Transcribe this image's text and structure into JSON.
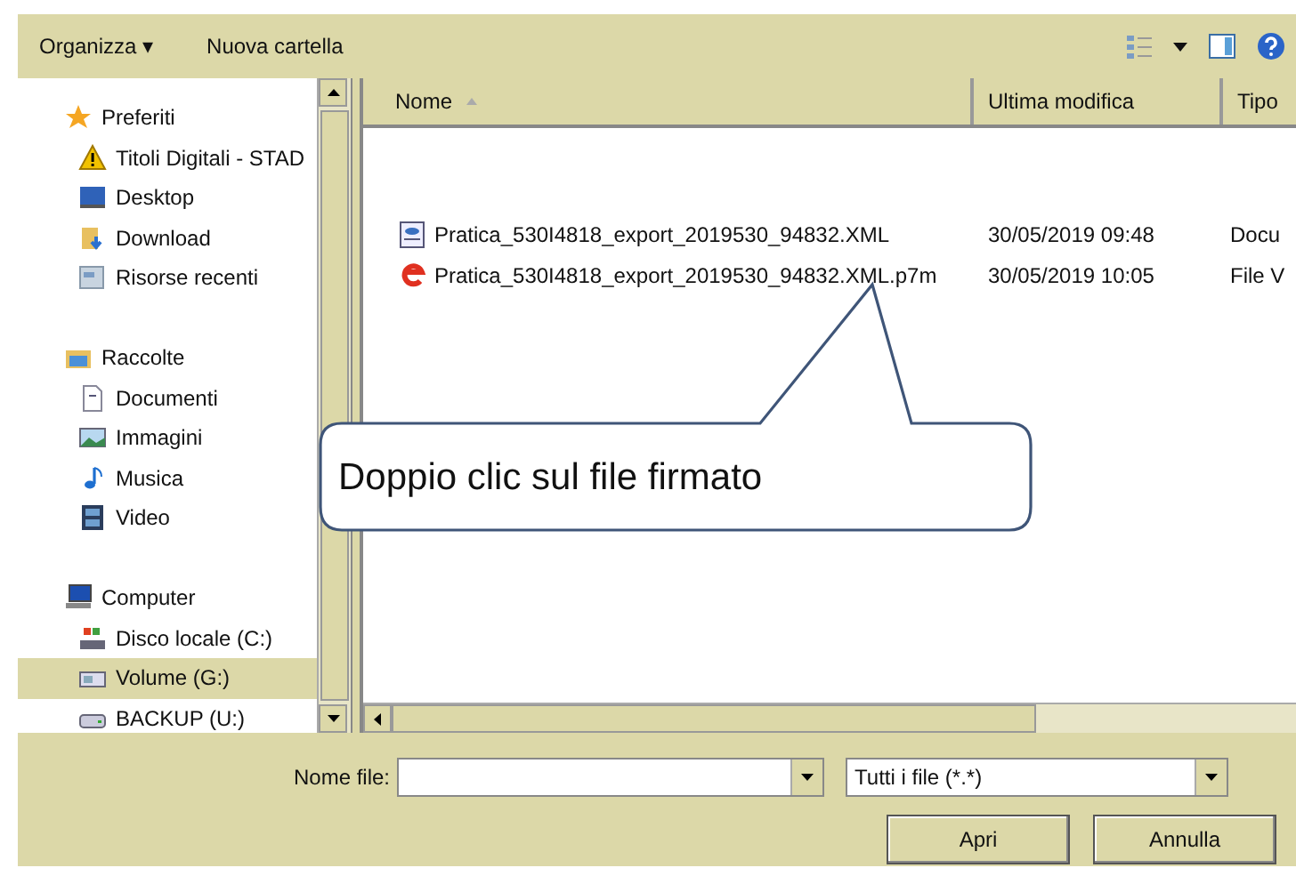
{
  "toolbar": {
    "organize": "Organizza ▾",
    "new_folder": "Nuova cartella"
  },
  "nav": [
    {
      "label": "Preferiti",
      "kind": "favorites",
      "selected": false,
      "children": [
        {
          "label": "Titoli Digitali - STAD",
          "kind": "warning",
          "selected": false
        },
        {
          "label": "Desktop",
          "kind": "desktop",
          "selected": false
        },
        {
          "label": "Download",
          "kind": "download",
          "selected": false
        },
        {
          "label": "Risorse recenti",
          "kind": "recent",
          "selected": false
        }
      ]
    },
    {
      "label": "Raccolte",
      "kind": "libraries",
      "selected": false,
      "children": [
        {
          "label": "Documenti",
          "kind": "document",
          "selected": false
        },
        {
          "label": "Immagini",
          "kind": "image",
          "selected": false
        },
        {
          "label": "Musica",
          "kind": "music",
          "selected": false
        },
        {
          "label": "Video",
          "kind": "video",
          "selected": false
        }
      ]
    },
    {
      "label": "Computer",
      "kind": "computer",
      "selected": false,
      "children": [
        {
          "label": "Disco locale (C:)",
          "kind": "disk",
          "selected": false
        },
        {
          "label": "Volume (G:)",
          "kind": "volume",
          "selected": true
        },
        {
          "label": "BACKUP (U:)",
          "kind": "drive",
          "selected": false
        }
      ]
    }
  ],
  "table": {
    "columns": [
      "Nome",
      "Ultima modifica",
      "Tipo"
    ],
    "rows": [
      {
        "kind": "xml",
        "name": "Pratica_530I4818_export_2019530_94832.XML",
        "modified": "30/05/2019 09:48",
        "type": "Docu"
      },
      {
        "kind": "signed",
        "name": "Pratica_530I4818_export_2019530_94832.XML.p7m",
        "modified": "30/05/2019 10:05",
        "type": "File V"
      }
    ]
  },
  "callout": "Doppio clic sul file firmato",
  "filename": {
    "label": "Nome file:"
  },
  "filter": "Tutti i file (*.*)",
  "buttons": [
    "Apri",
    "Annulla"
  ]
}
